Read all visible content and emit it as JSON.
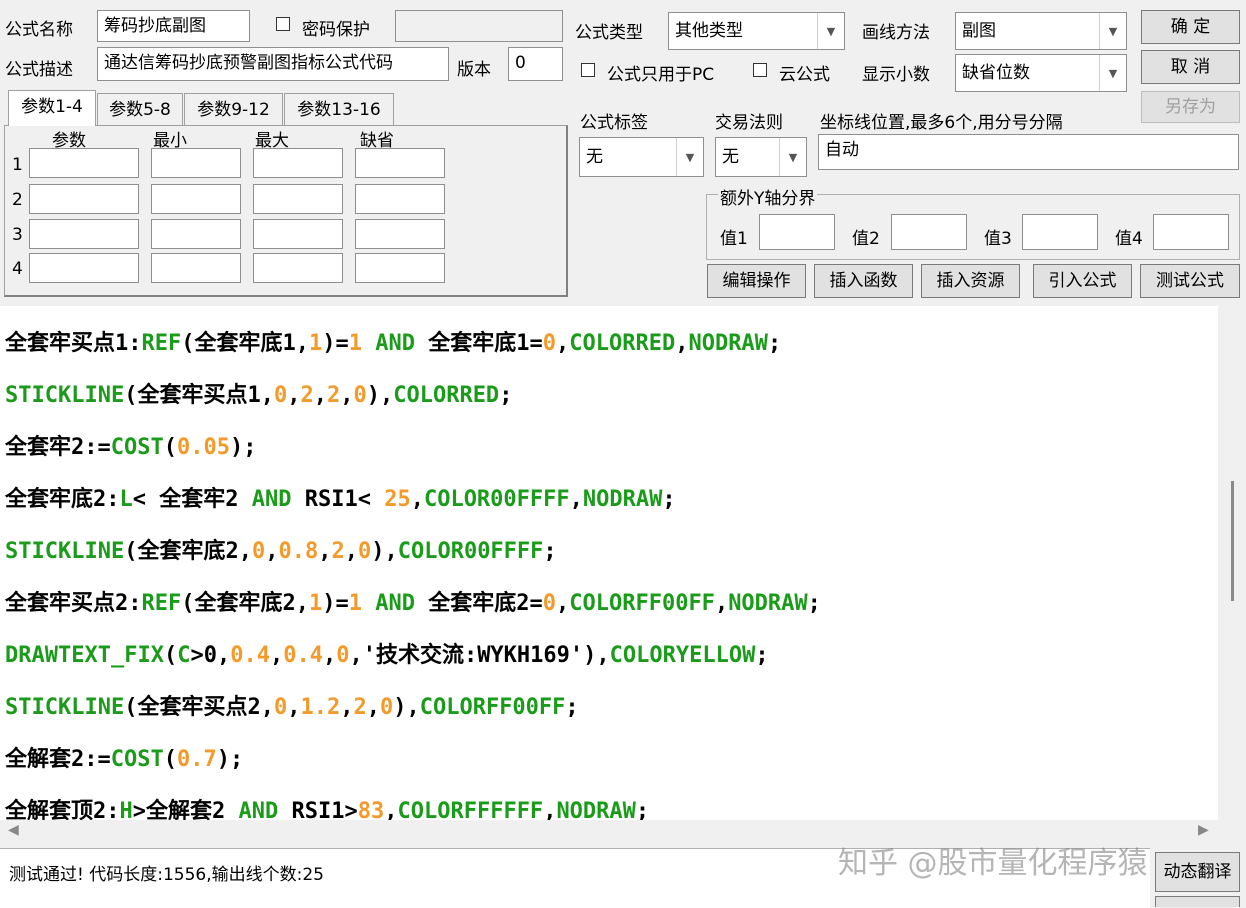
{
  "header": {
    "formula_name_label": "公式名称",
    "formula_name_value": "筹码抄底副图",
    "password_label": "密码保护",
    "formula_desc_label": "公式描述",
    "formula_desc_value": "通达信筹码抄底预警副图指标公式代码",
    "version_label": "版本",
    "version_value": "0",
    "formula_type_label": "公式类型",
    "formula_type_value": "其他类型",
    "draw_method_label": "画线方法",
    "draw_method_value": "副图",
    "pc_only_label": "公式只用于PC",
    "cloud_label": "云公式",
    "decimals_label": "显示小数",
    "decimals_value": "缺省位数",
    "ok_button": "确 定",
    "cancel_button": "取 消",
    "save_as_button": "另存为"
  },
  "params": {
    "tabs": [
      "参数1-4",
      "参数5-8",
      "参数9-12",
      "参数13-16"
    ],
    "columns": [
      "参数",
      "最小",
      "最大",
      "缺省"
    ],
    "rows": [
      "1",
      "2",
      "3",
      "4"
    ]
  },
  "right_panel": {
    "tag_label": "公式标签",
    "tag_value": "无",
    "rule_label": "交易法则",
    "rule_value": "无",
    "axis_label": "坐标线位置,最多6个,用分号分隔",
    "axis_value": "自动",
    "extra_y_label": "额外Y轴分界",
    "value_labels": [
      "值1",
      "值2",
      "值3",
      "值4"
    ]
  },
  "toolbar": {
    "buttons": [
      "编辑操作",
      "插入函数",
      "插入资源",
      "引入公式",
      "测试公式"
    ]
  },
  "code": {
    "lines": [
      [
        [
          "全套牢买点1:",
          "black"
        ],
        [
          "REF",
          "green"
        ],
        [
          "(全套牢底1,",
          "black"
        ],
        [
          "1",
          "orange"
        ],
        [
          ")=",
          "black"
        ],
        [
          "1",
          "orange"
        ],
        [
          " AND ",
          "green"
        ],
        [
          "全套牢底1=",
          "black"
        ],
        [
          "0",
          "orange"
        ],
        [
          ",",
          "black"
        ],
        [
          "COLORRED",
          "green"
        ],
        [
          ",",
          "black"
        ],
        [
          "NODRAW",
          "green"
        ],
        [
          ";",
          "black"
        ]
      ],
      [
        [
          "STICKLINE",
          "green"
        ],
        [
          "(全套牢买点1,",
          "black"
        ],
        [
          "0",
          "orange"
        ],
        [
          ",",
          "black"
        ],
        [
          "2",
          "orange"
        ],
        [
          ",",
          "black"
        ],
        [
          "2",
          "orange"
        ],
        [
          ",",
          "black"
        ],
        [
          "0",
          "orange"
        ],
        [
          "),",
          "black"
        ],
        [
          "COLORRED",
          "green"
        ],
        [
          ";",
          "black"
        ]
      ],
      [
        [
          "全套牢2:=",
          "black"
        ],
        [
          "COST",
          "green"
        ],
        [
          "(",
          "black"
        ],
        [
          "0.05",
          "orange"
        ],
        [
          ");",
          "black"
        ]
      ],
      [
        [
          "全套牢底2:",
          "black"
        ],
        [
          "L",
          "green"
        ],
        [
          "< 全套牢2 ",
          "black"
        ],
        [
          "AND",
          "green"
        ],
        [
          " RSI1< ",
          "black"
        ],
        [
          "25",
          "orange"
        ],
        [
          ",",
          "black"
        ],
        [
          "COLOR00FFFF",
          "green"
        ],
        [
          ",",
          "black"
        ],
        [
          "NODRAW",
          "green"
        ],
        [
          ";",
          "black"
        ]
      ],
      [
        [
          "STICKLINE",
          "green"
        ],
        [
          "(全套牢底2,",
          "black"
        ],
        [
          "0",
          "orange"
        ],
        [
          ",",
          "black"
        ],
        [
          "0.8",
          "orange"
        ],
        [
          ",",
          "black"
        ],
        [
          "2",
          "orange"
        ],
        [
          ",",
          "black"
        ],
        [
          "0",
          "orange"
        ],
        [
          "),",
          "black"
        ],
        [
          "COLOR00FFFF",
          "green"
        ],
        [
          ";",
          "black"
        ]
      ],
      [
        [
          "全套牢买点2:",
          "black"
        ],
        [
          "REF",
          "green"
        ],
        [
          "(全套牢底2,",
          "black"
        ],
        [
          "1",
          "orange"
        ],
        [
          ")=",
          "black"
        ],
        [
          "1",
          "orange"
        ],
        [
          " AND ",
          "green"
        ],
        [
          "全套牢底2=",
          "black"
        ],
        [
          "0",
          "orange"
        ],
        [
          ",",
          "black"
        ],
        [
          "COLORFF00FF",
          "green"
        ],
        [
          ",",
          "black"
        ],
        [
          "NODRAW",
          "green"
        ],
        [
          ";",
          "black"
        ]
      ],
      [
        [
          "DRAWTEXT_FIX",
          "green"
        ],
        [
          "(",
          "black"
        ],
        [
          "C",
          "green"
        ],
        [
          ">0,",
          "black"
        ],
        [
          "0.4",
          "orange"
        ],
        [
          ",",
          "black"
        ],
        [
          "0.4",
          "orange"
        ],
        [
          ",",
          "black"
        ],
        [
          "0",
          "orange"
        ],
        [
          ",'技术交流:WYKH169'),",
          "black"
        ],
        [
          "COLORYELLOW",
          "green"
        ],
        [
          ";",
          "black"
        ]
      ],
      [
        [
          "STICKLINE",
          "green"
        ],
        [
          "(全套牢买点2,",
          "black"
        ],
        [
          "0",
          "orange"
        ],
        [
          ",",
          "black"
        ],
        [
          "1.2",
          "orange"
        ],
        [
          ",",
          "black"
        ],
        [
          "2",
          "orange"
        ],
        [
          ",",
          "black"
        ],
        [
          "0",
          "orange"
        ],
        [
          "),",
          "black"
        ],
        [
          "COLORFF00FF",
          "green"
        ],
        [
          ";",
          "black"
        ]
      ],
      [
        [
          "全解套2:=",
          "black"
        ],
        [
          "COST",
          "green"
        ],
        [
          "(",
          "black"
        ],
        [
          "0.7",
          "orange"
        ],
        [
          ");",
          "black"
        ]
      ],
      [
        [
          "全解套顶2:",
          "black"
        ],
        [
          "H",
          "green"
        ],
        [
          ">全解套2 ",
          "black"
        ],
        [
          "AND",
          "green"
        ],
        [
          " RSI1>",
          "black"
        ],
        [
          "83",
          "orange"
        ],
        [
          ",",
          "black"
        ],
        [
          "COLORFFFFFF",
          "green"
        ],
        [
          ",",
          "black"
        ],
        [
          "NODRAW",
          "green"
        ],
        [
          ";",
          "black"
        ]
      ]
    ]
  },
  "status": {
    "message": "测试通过! 代码长度:1556,输出线个数:25",
    "watermark": "知乎 @股市量化程序猿",
    "translate_button": "动态翻译"
  },
  "colors": {
    "keyword_green": "#1a9c1a",
    "number_orange": "#f39a2b",
    "window_bg": "#f0f0f0"
  }
}
